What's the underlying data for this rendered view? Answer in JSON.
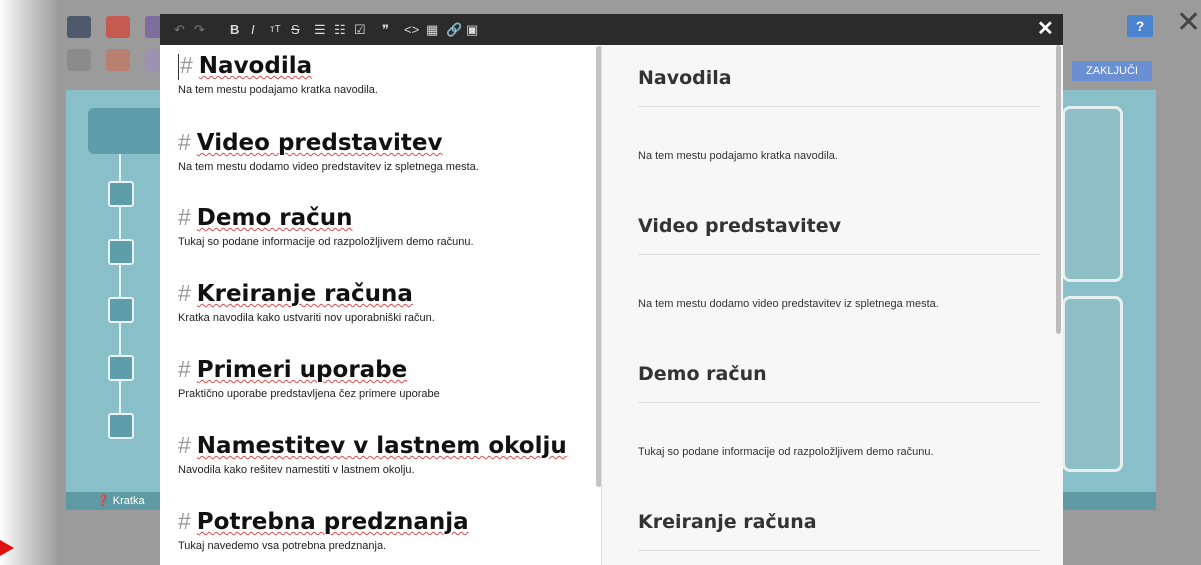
{
  "background_app": {
    "help_label": "?",
    "finish_button": "ZAKLJUČI",
    "footer_text": "Kratka",
    "footer_icon": "question-circle-icon",
    "swatch_colors": [
      "#4c5a6c",
      "#c45a52",
      "#7e6e9e",
      "#8c8c8c",
      "#b98070",
      "#9e92b2"
    ]
  },
  "toolbar": {
    "buttons": [
      {
        "name": "undo",
        "glyph": "↶"
      },
      {
        "name": "redo",
        "glyph": "↷"
      },
      {
        "name": "bold",
        "glyph": "B"
      },
      {
        "name": "italic",
        "glyph": "I"
      },
      {
        "name": "heading",
        "glyph": "ᴛT"
      },
      {
        "name": "strikethrough",
        "glyph": "S"
      },
      {
        "name": "unordered-list",
        "glyph": "☰"
      },
      {
        "name": "ordered-list",
        "glyph": "☷"
      },
      {
        "name": "task-list",
        "glyph": "☑"
      },
      {
        "name": "quote",
        "glyph": "❞"
      },
      {
        "name": "code",
        "glyph": "<>"
      },
      {
        "name": "table",
        "glyph": "▦"
      },
      {
        "name": "link",
        "glyph": "🔗"
      },
      {
        "name": "image",
        "glyph": "▣"
      }
    ],
    "close_glyph": "✕"
  },
  "editor": {
    "sections": [
      {
        "hash": "#",
        "title": "Navodila",
        "text": "Na tem mestu podajamo kratka navodila."
      },
      {
        "hash": "#",
        "title": "Video predstavitev",
        "text": "Na tem mestu dodamo video predstavitev iz spletnega mesta."
      },
      {
        "hash": "#",
        "title": "Demo račun",
        "text": "Tukaj so podane informacije od razpoložljivem demo računu."
      },
      {
        "hash": "#",
        "title": "Kreiranje računa",
        "text": "Kratka navodila kako ustvariti nov uporabniški račun."
      },
      {
        "hash": "#",
        "title": "Primeri uporabe",
        "text": "Praktično uporabe predstavljena čez primere uporabe"
      },
      {
        "hash": "#",
        "title": "Namestitev v lastnem okolju",
        "text": "Navodila kako rešitev namestiti v lastnem okolju."
      },
      {
        "hash": "#",
        "title": "Potrebna predznanja",
        "text": "Tukaj navedemo vsa potrebna predznanja."
      }
    ]
  },
  "preview": {
    "sections": [
      {
        "title": "Navodila",
        "text": "Na tem mestu podajamo kratka navodila."
      },
      {
        "title": "Video predstavitev",
        "text": "Na tem mestu dodamo video predstavitev iz spletnega mesta."
      },
      {
        "title": "Demo račun",
        "text": "Tukaj so podane informacije od razpoložljivem demo računu."
      },
      {
        "title": "Kreiranje računa",
        "text": ""
      }
    ]
  }
}
